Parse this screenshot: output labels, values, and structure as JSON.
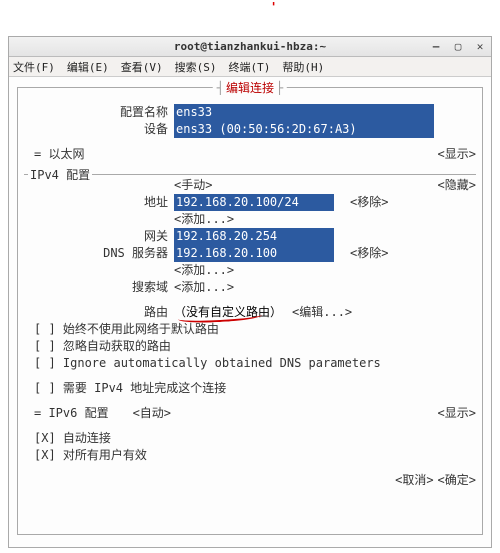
{
  "window": {
    "title": "root@tianzhankui-hbza:~",
    "controls": {
      "min": "—",
      "max": "▢",
      "close": "✕"
    }
  },
  "menubar": {
    "file": "文件(F)",
    "edit": "编辑(E)",
    "view": "查看(V)",
    "search": "搜索(S)",
    "terminal": "终端(T)",
    "help": "帮助(H)"
  },
  "dialog": {
    "title": "编辑连接",
    "profile_label": "配置名称",
    "profile_value": "ens33",
    "device_label": "设备",
    "device_value": "ens33 (00:50:56:2D:67:A3)",
    "ethernet_label": "= 以太网",
    "show": "<显示>",
    "ipv4": {
      "header": "IPv4 配置",
      "mode": "<手动>",
      "hide": "<隐藏>",
      "addr_label": "地址",
      "addr_value": "192.168.20.100/24",
      "remove": "<移除>",
      "add": "<添加...>",
      "gw_label": "网关",
      "gw_value": "192.168.20.254",
      "dns_label": "DNS 服务器",
      "dns_value": "192.168.20.100",
      "search_label": "搜索域",
      "routes_label": "路由",
      "routes_text": "（没有自定义路由）",
      "edit": "<编辑...>",
      "cb1": "[ ] 始终不使用此网络于默认路由",
      "cb2": "[ ] 忽略自动获取的路由",
      "cb3": "[ ] Ignore automatically obtained DNS parameters",
      "cb4": "[ ] 需要 IPv4 地址完成这个连接"
    },
    "ipv6": {
      "header": "= IPv6 配置",
      "mode": "<自动>",
      "show": "<显示>"
    },
    "auto_conn": "[X] 自动连接",
    "all_users": "[X] 对所有用户有效",
    "cancel": "<取消>",
    "ok": "<确定>"
  }
}
